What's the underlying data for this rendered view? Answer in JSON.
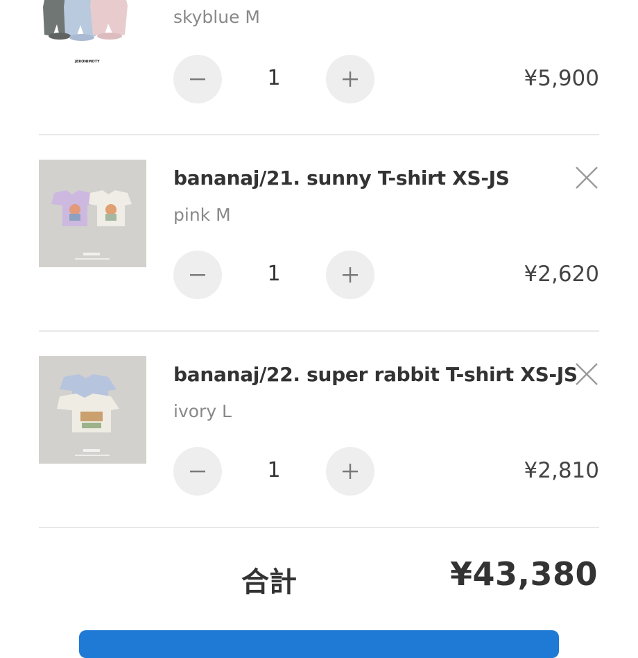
{
  "cart": {
    "items": [
      {
        "title": "",
        "variant": "skyblue M",
        "quantity": "1",
        "price": "¥5,900",
        "image_caption": "JERONIMOTY"
      },
      {
        "title": "bananaj/21. sunny T-shirt XS-JS",
        "variant": "pink M",
        "quantity": "1",
        "price": "¥2,620"
      },
      {
        "title": "bananaj/22. super rabbit T-shirt XS-JS",
        "variant": "ivory L",
        "quantity": "1",
        "price": "¥2,810"
      }
    ],
    "total_label": "合計",
    "total_value": "¥43,380"
  },
  "icons": {
    "decrement": "minus-icon",
    "increment": "plus-icon",
    "remove": "close-icon"
  },
  "colors": {
    "accent": "#1f7ad6",
    "button_bg": "#eeeeee",
    "divider": "#e8e8e8",
    "muted_text": "#888888"
  }
}
